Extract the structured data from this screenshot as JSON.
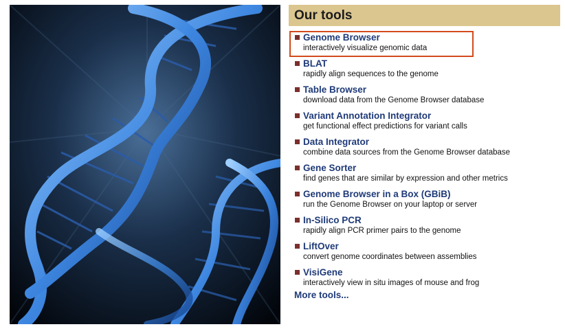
{
  "hero": {
    "image_icon": "dna-helix-image"
  },
  "panel": {
    "title": "Our tools",
    "tools": [
      {
        "name": "Genome Browser",
        "desc": "interactively visualize genomic data"
      },
      {
        "name": "BLAT",
        "desc": "rapidly align sequences to the genome"
      },
      {
        "name": "Table Browser",
        "desc": "download data from the Genome Browser database"
      },
      {
        "name": "Variant Annotation Integrator",
        "desc": "get functional effect predictions for variant calls"
      },
      {
        "name": "Data Integrator",
        "desc": "combine data sources from the Genome Browser database"
      },
      {
        "name": "Gene Sorter",
        "desc": "find genes that are similar by expression and other metrics"
      },
      {
        "name": "Genome Browser in a Box (GBiB)",
        "desc": "run the Genome Browser on your laptop or server"
      },
      {
        "name": "In-Silico PCR",
        "desc": "rapidly align PCR primer pairs to the genome"
      },
      {
        "name": "LiftOver",
        "desc": "convert genome coordinates between assemblies"
      },
      {
        "name": "VisiGene",
        "desc": "interactively view in situ images of mouse and frog"
      }
    ],
    "more_label": "More tools..."
  },
  "colors": {
    "header_bg": "#dbc68f",
    "link": "#1f3a78",
    "bullet": "#7b2f2c",
    "highlight": "#d24a1c"
  }
}
